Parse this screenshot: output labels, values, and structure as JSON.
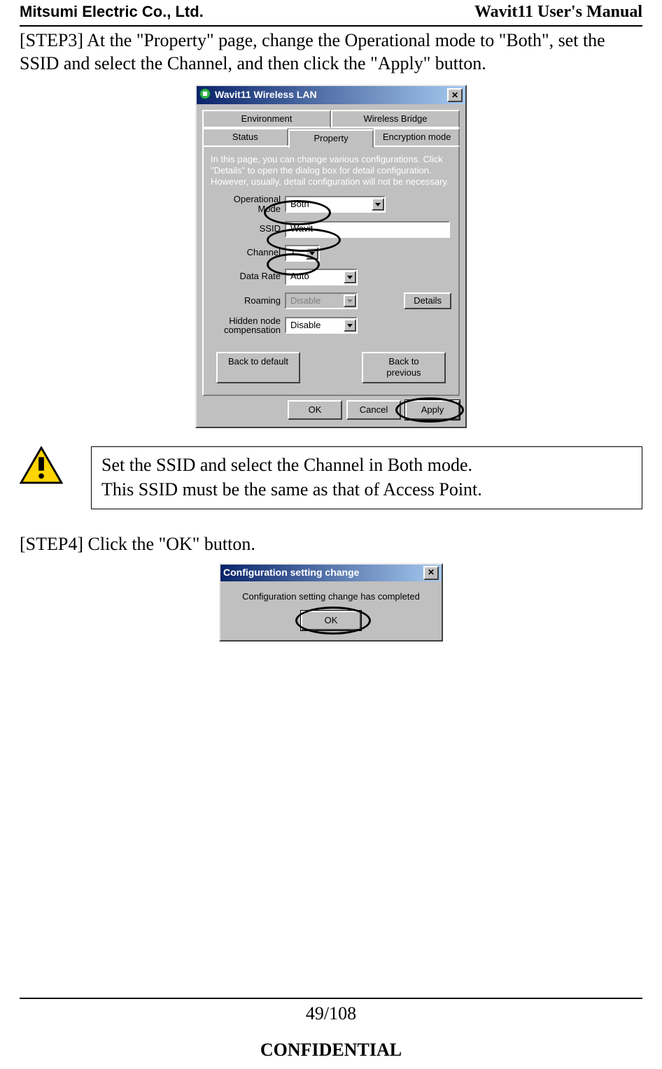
{
  "header": {
    "left": "Mitsumi Electric Co., Ltd.",
    "right": "Wavit11 User's Manual"
  },
  "step3_text": "[STEP3] At the \"Property\" page, change the Operational mode to \"Both\", set the SSID and select the Channel, and then click the \"Apply\" button.",
  "dialog1": {
    "title": "Wavit11 Wireless LAN",
    "tabs_top": [
      "Environment",
      "Wireless Bridge"
    ],
    "tabs_bottom": [
      "Status",
      "Property",
      "Encryption mode"
    ],
    "active_tab": "Property",
    "panel_text": "In this page, you can change various configurations. Click \"Details\" to open the dialog box for detail configuration. However, usually, detail configuration will not be necessary.",
    "fields": {
      "operational_mode": {
        "label": "Operational Mode",
        "value": "Both"
      },
      "ssid": {
        "label": "SSID",
        "value": "Wavit"
      },
      "channel": {
        "label": "Channel",
        "value": "1"
      },
      "data_rate": {
        "label": "Data Rate",
        "value": "Auto"
      },
      "roaming": {
        "label": "Roaming",
        "value": "Disable"
      },
      "hidden_node": {
        "label": "Hidden node compensation",
        "value": "Disable"
      }
    },
    "details_button": "Details",
    "back_default": "Back to default",
    "back_previous": "Back to previous",
    "ok": "OK",
    "cancel": "Cancel",
    "apply": "Apply"
  },
  "note": {
    "line1": "Set the SSID and select the Channel in Both mode.",
    "line2": "This SSID must be the same as that of Access Point."
  },
  "step4_text": "[STEP4] Click the \"OK\" button.",
  "dialog2": {
    "title": "Configuration setting change",
    "message": "Configuration setting change has completed",
    "ok": "OK"
  },
  "footer": {
    "page": "49/108",
    "confidential": "CONFIDENTIAL"
  }
}
